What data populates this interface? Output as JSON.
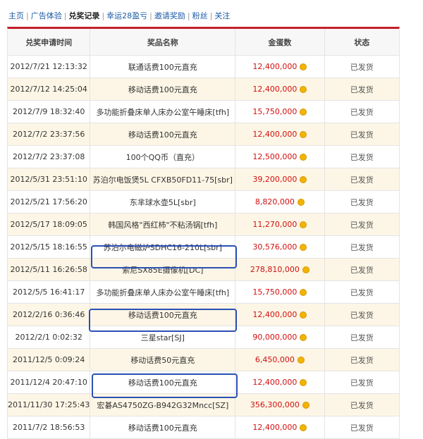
{
  "nav": {
    "items": [
      {
        "label": "主页"
      },
      {
        "label": "广告体验"
      },
      {
        "label": "兑奖记录",
        "active": true
      },
      {
        "label": "幸运28盈亏"
      },
      {
        "label": "邀请奖励"
      },
      {
        "label": "粉丝"
      },
      {
        "label": "关注"
      }
    ]
  },
  "table": {
    "headers": {
      "time": "兑奖申请时间",
      "prize": "奖品名称",
      "amount": "金蛋数",
      "status": "状态"
    },
    "rows": [
      {
        "time": "2012/7/21 12:13:32",
        "prize": "联通话费100元直充",
        "amount": "12,400,000",
        "status": "已发货"
      },
      {
        "time": "2012/7/12 14:25:04",
        "prize": "移动话费100元直充",
        "amount": "12,400,000",
        "status": "已发货"
      },
      {
        "time": "2012/7/9 18:32:40",
        "prize": "多功能折叠床单人床办公室午睡床[tfh]",
        "amount": "15,750,000",
        "status": "已发货"
      },
      {
        "time": "2012/7/2 23:37:56",
        "prize": "移动话费100元直充",
        "amount": "12,400,000",
        "status": "已发货"
      },
      {
        "time": "2012/7/2 23:37:08",
        "prize": "100个QQ币（直充）",
        "amount": "12,500,000",
        "status": "已发货"
      },
      {
        "time": "2012/5/31 23:51:10",
        "prize": "苏泊尔电饭煲5L CFXB50FD11-75[sbr]",
        "amount": "39,200,000",
        "status": "已发货"
      },
      {
        "time": "2012/5/21 17:56:20",
        "prize": "东芈球水壶5L[sbr]",
        "amount": "8,820,000",
        "status": "已发货"
      },
      {
        "time": "2012/5/17 18:09:05",
        "prize": "韩国风格\"西红柿\"不粘汤锅[tfh]",
        "amount": "11,270,000",
        "status": "已发货"
      },
      {
        "time": "2012/5/15 18:16:55",
        "prize": "苏泊尔电磁炉SDHC16-210L[sbr]",
        "amount": "30,576,000",
        "status": "已发货"
      },
      {
        "time": "2012/5/11 16:26:58",
        "prize": "索尼SX85E摄像机[DC]",
        "amount": "278,810,000",
        "status": "已发货"
      },
      {
        "time": "2012/5/5 16:41:17",
        "prize": "多功能折叠床单人床办公室午睡床[tfh]",
        "amount": "15,750,000",
        "status": "已发货"
      },
      {
        "time": "2012/2/16 0:36:46",
        "prize": "移动话费100元直充",
        "amount": "12,400,000",
        "status": "已发货"
      },
      {
        "time": "2012/2/1 0:02:32",
        "prize": "三星star[SJ]",
        "amount": "90,000,000",
        "status": "已发货"
      },
      {
        "time": "2011/12/5 0:09:24",
        "prize": "移动话费50元直充",
        "amount": "6,450,000",
        "status": "已发货"
      },
      {
        "time": "2011/12/4 20:47:10",
        "prize": "移动话费100元直充",
        "amount": "12,400,000",
        "status": "已发货"
      },
      {
        "time": "2011/11/30 17:25:43",
        "prize": "宏碁AS4750ZG-B942G32Mncc[SZ]",
        "amount": "356,300,000",
        "status": "已发货"
      },
      {
        "time": "2011/7/2 18:56:53",
        "prize": "移动话费100元直充",
        "amount": "12,400,000",
        "status": "已发货"
      }
    ]
  },
  "colors": {
    "accent": "#c3202a",
    "amount": "#d10f0f",
    "highlight_box": "#2c50b5",
    "alt_row": "#fdf6e6"
  },
  "icons": {
    "coin": "gold-egg-coin-icon"
  }
}
